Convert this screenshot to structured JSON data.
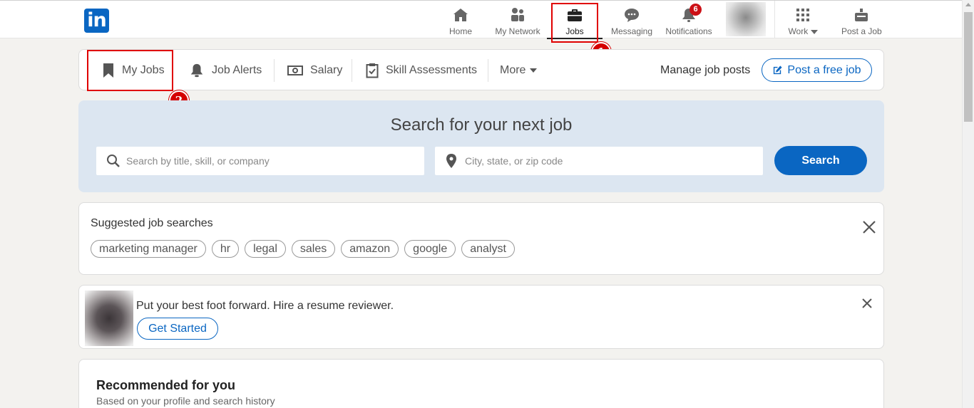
{
  "brand": {
    "logo_text": "in",
    "accent": "#0a66c2"
  },
  "topnav": {
    "items": [
      {
        "label": "Home",
        "icon": "home-icon"
      },
      {
        "label": "My Network",
        "icon": "network-icon"
      },
      {
        "label": "Jobs",
        "icon": "briefcase-icon",
        "active": true
      },
      {
        "label": "Messaging",
        "icon": "chat-icon"
      },
      {
        "label": "Notifications",
        "icon": "bell-icon",
        "badge": "6"
      },
      {
        "label": "Work",
        "icon": "grid-icon"
      },
      {
        "label": "Post a Job",
        "icon": "post-job-icon"
      }
    ]
  },
  "annotations": {
    "one": "1",
    "two": "2"
  },
  "jobs_nav": {
    "my_jobs": "My Jobs",
    "job_alerts": "Job Alerts",
    "salary": "Salary",
    "skill_assessments": "Skill Assessments",
    "more": "More",
    "manage_posts": "Manage job posts",
    "post_free_job": "Post a free job"
  },
  "search": {
    "title": "Search for your next job",
    "keyword_placeholder": "Search by title, skill, or company",
    "location_placeholder": "City, state, or zip code",
    "button": "Search"
  },
  "suggested": {
    "title": "Suggested job searches",
    "chips": [
      "marketing manager",
      "hr",
      "legal",
      "sales",
      "amazon",
      "google",
      "analyst"
    ]
  },
  "promo": {
    "text": "Put your best foot forward. Hire a resume reviewer.",
    "button": "Get Started"
  },
  "recommended": {
    "title": "Recommended for you",
    "subtitle": "Based on your profile and search history"
  }
}
